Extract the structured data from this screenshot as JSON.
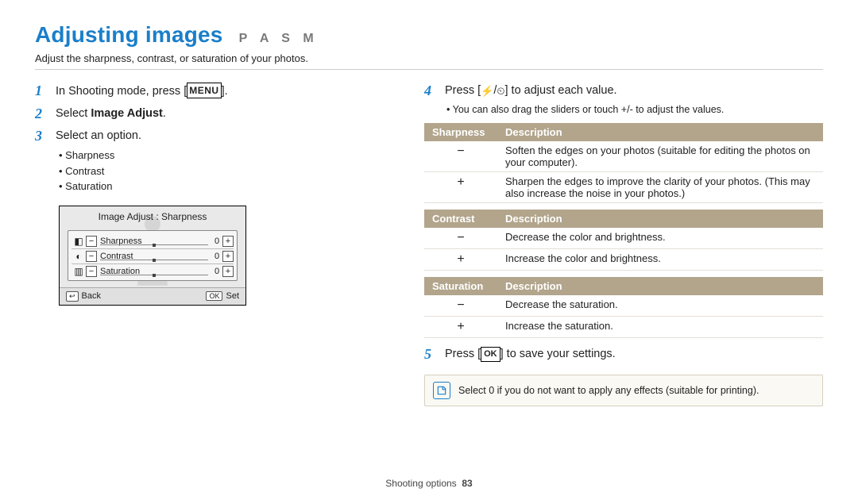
{
  "header": {
    "title": "Adjusting images",
    "modes": "P A S M",
    "subtitle": "Adjust the sharpness, contrast, or saturation of your photos."
  },
  "left": {
    "step1": {
      "num": "1",
      "pre": "In Shooting mode, press [",
      "menu": "MENU",
      "post": "]."
    },
    "step2": {
      "num": "2",
      "pre": "Select ",
      "bold": "Image Adjust",
      "post": "."
    },
    "step3": {
      "num": "3",
      "text": "Select an option."
    },
    "options": [
      "Sharpness",
      "Contrast",
      "Saturation"
    ],
    "screen": {
      "title": "Image Adjust : Sharpness",
      "rows": [
        {
          "icon": "◧",
          "label": "Sharpness",
          "value": "0"
        },
        {
          "icon": "◐",
          "label": "Contrast",
          "value": "0"
        },
        {
          "icon": "▥",
          "label": "Saturation",
          "value": "0"
        }
      ],
      "back_btn": "↩",
      "back_label": "Back",
      "ok_btn": "OK",
      "ok_label": "Set"
    }
  },
  "right": {
    "step4": {
      "num": "4",
      "pre": "Press [",
      "g1": "⚡",
      "sep": "/",
      "g2": "⏲",
      "post": "] to adjust each value."
    },
    "note4": "You can also drag the sliders or touch +/- to adjust the values.",
    "tables": {
      "sharpness": {
        "h1": "Sharpness",
        "h2": "Description",
        "rows": [
          {
            "sign": "−",
            "text": "Soften the edges on your photos (suitable for editing the photos on your computer)."
          },
          {
            "sign": "+",
            "text": "Sharpen the edges to improve the clarity of your photos. (This may also increase the noise in your photos.)"
          }
        ]
      },
      "contrast": {
        "h1": "Contrast",
        "h2": "Description",
        "rows": [
          {
            "sign": "−",
            "text": "Decrease the color and brightness."
          },
          {
            "sign": "+",
            "text": "Increase the color and brightness."
          }
        ]
      },
      "saturation": {
        "h1": "Saturation",
        "h2": "Description",
        "rows": [
          {
            "sign": "−",
            "text": "Decrease the saturation."
          },
          {
            "sign": "+",
            "text": "Increase the saturation."
          }
        ]
      }
    },
    "step5": {
      "num": "5",
      "pre": "Press [",
      "ok": "OK",
      "post": "] to save your settings."
    },
    "tip": "Select 0 if you do not want to apply any effects (suitable for printing)."
  },
  "footer": {
    "section": "Shooting options",
    "page": "83"
  }
}
